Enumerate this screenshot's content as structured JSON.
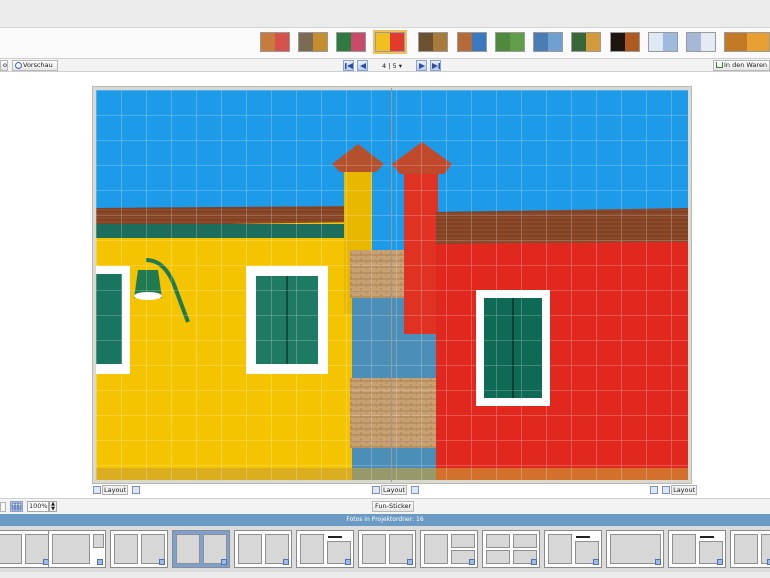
{
  "toolbar": {
    "left_stub_label": "o",
    "preview_label": "Vorschau",
    "page_indicator": "4 | 5",
    "page_dropdown_arrow": "▾",
    "cart_label": "In den Waren"
  },
  "thumbnails": {
    "items": [
      {
        "left_color": "#c77b3d",
        "right_color": "#d7504a"
      },
      {
        "left_color": "#7b6b55",
        "right_color": "#c68d2e"
      },
      {
        "left_color": "#2f7a3f",
        "right_color": "#c94a6a"
      },
      {
        "left_color": "#f0c020",
        "right_color": "#e23b2e"
      },
      {
        "left_color": "#6a5230",
        "right_color": "#a87b3a"
      },
      {
        "left_color": "#b56a3a",
        "right_color": "#3a79c0"
      },
      {
        "left_color": "#4f8a3c",
        "right_color": "#5f9f4a"
      },
      {
        "left_color": "#4a7db3",
        "right_color": "#6fa0d0"
      },
      {
        "left_color": "#38673a",
        "right_color": "#d39a3c"
      },
      {
        "left_color": "#1e1410",
        "right_color": "#b05a20"
      },
      {
        "left_color": "#dfe9f5",
        "right_color": "#9ebadf"
      },
      {
        "left_color": "#a7b7d6",
        "right_color": "#e5eaf3"
      },
      {
        "left_color": "#c27a27",
        "right_color": "#e8a032"
      }
    ],
    "selected_index": 3
  },
  "page": {
    "layout_button_label": "Layout",
    "spine_visible": true
  },
  "bottom": {
    "zoom_value": "100%",
    "fun_sticker_label": "Fun-Sticker",
    "folder_label": "Fotos in Projektordner: 16"
  },
  "colors": {
    "sky": "#1e9be8",
    "yellow_wall": "#f4c400",
    "red_wall": "#e0281f",
    "roof": "#9b4a2b",
    "window_frame": "#ffffff",
    "shutter": "#1f7a63",
    "folder_bar": "#6b9ac4"
  }
}
